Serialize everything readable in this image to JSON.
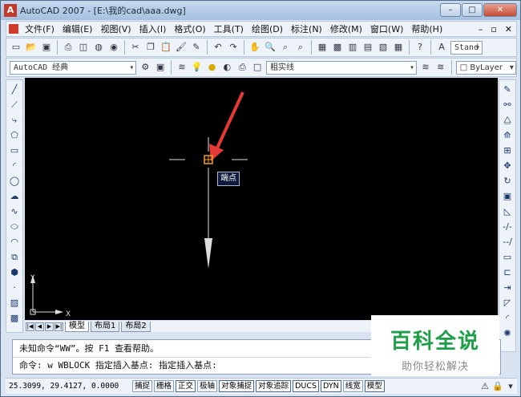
{
  "window": {
    "title": "AutoCAD 2007 - [E:\\我的cad\\aaa.dwg]",
    "min": "–",
    "max": "□",
    "close": "✕"
  },
  "menu": {
    "items": [
      "文件(F)",
      "编辑(E)",
      "视图(V)",
      "插入(I)",
      "格式(O)",
      "工具(T)",
      "绘图(D)",
      "标注(N)",
      "修改(M)",
      "窗口(W)",
      "帮助(H)"
    ],
    "doc_controls": [
      "–",
      "▫",
      "✕"
    ]
  },
  "toolbar": {
    "style_combo": "Stand",
    "workspace_combo": "AutoCAD 经典",
    "layer_combo": "粗实线",
    "color_combo": "ByLayer"
  },
  "canvas": {
    "tooltip": "端点",
    "ucs_x": "X",
    "ucs_y": "Y"
  },
  "tabs": [
    "模型",
    "布局1",
    "布局2"
  ],
  "command": {
    "line1": "未知命令“WW”。按 F1 查看帮助。",
    "line2": "命令: w WBLOCK 指定插入基点: 指定插入基点:"
  },
  "status": {
    "coords": "25.3099, 29.4127, 0.0000",
    "buttons": [
      {
        "label": "捕捉",
        "on": false
      },
      {
        "label": "栅格",
        "on": false
      },
      {
        "label": "正交",
        "on": true
      },
      {
        "label": "极轴",
        "on": false
      },
      {
        "label": "对象捕捉",
        "on": true
      },
      {
        "label": "对象追踪",
        "on": true
      },
      {
        "label": "DUCS",
        "on": true
      },
      {
        "label": "DYN",
        "on": true
      },
      {
        "label": "线宽",
        "on": false
      },
      {
        "label": "模型",
        "on": true
      }
    ]
  },
  "watermark": {
    "title": "百科全说",
    "subtitle": "助你轻松解决"
  },
  "colors": {
    "canvas_bg": "#000000",
    "arrow": "#e53935",
    "crosshair": "#ffffff",
    "snap_marker": "#f0a030"
  }
}
